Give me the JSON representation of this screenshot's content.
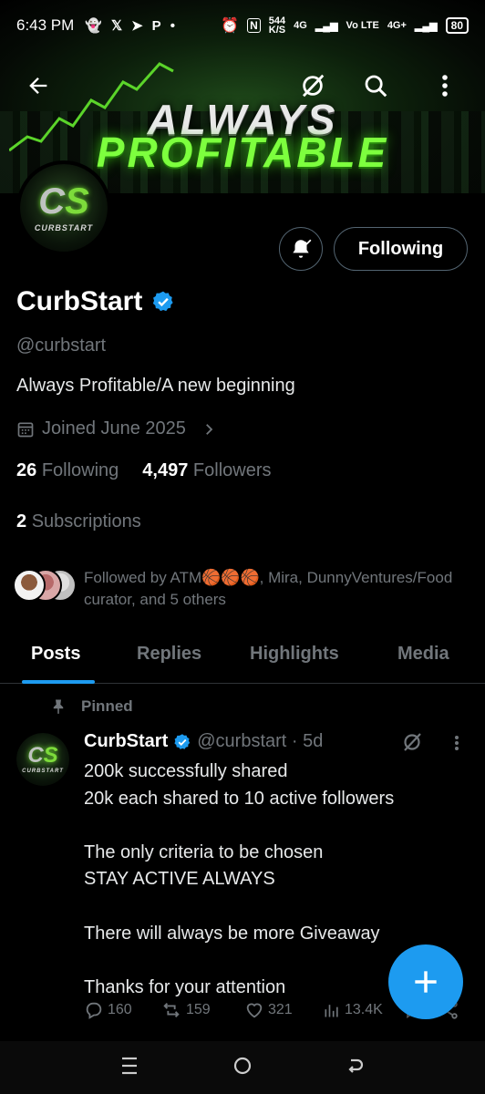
{
  "status_bar": {
    "time": "6:43 PM",
    "speed": "544",
    "speed_unit": "K/S",
    "net1": "4G",
    "volte": "Vo LTE",
    "net2": "4G+",
    "battery": "80"
  },
  "banner": {
    "line1": "ALWAYS",
    "line2": "PROFITABLE"
  },
  "avatar": {
    "letters_a": "C",
    "letters_b": "S",
    "word": "CURBSTART"
  },
  "profile": {
    "name": "CurbStart",
    "handle": "@curbstart",
    "bio": "Always Profitable/A new beginning",
    "joined": "Joined June 2025",
    "following_count": "26",
    "following_label": "Following",
    "followers_count": "4,497",
    "followers_label": "Followers",
    "subscriptions_count": "2",
    "subscriptions_label": "Subscriptions",
    "followed_by": "Followed by ATM🏀🏀🏀, Mira, DunnyVentures/Food curator, and 5 others",
    "follow_button": "Following"
  },
  "tabs": [
    {
      "label": "Posts"
    },
    {
      "label": "Replies"
    },
    {
      "label": "Highlights"
    },
    {
      "label": "Media"
    }
  ],
  "post": {
    "pinned_label": "Pinned",
    "author": "CurbStart",
    "handle_time": "@curbstart · 5d",
    "lines": [
      "200k successfully shared",
      "20k each shared to 10 active followers",
      "",
      "The only criteria to be chosen",
      "STAY ACTIVE ALWAYS",
      "",
      "There will always be more Giveaway",
      "",
      "Thanks for your attention"
    ],
    "replies": "160",
    "reposts": "159",
    "likes": "321",
    "views": "13.4K"
  },
  "colors": {
    "accent": "#1d9bf0",
    "banner_green": "#7dff3e",
    "muted": "#71767b"
  },
  "icons": [
    "back-arrow-icon",
    "grok-icon",
    "search-icon",
    "more-vertical-icon",
    "bell-icon",
    "verified-icon",
    "calendar-icon",
    "chevron-right-icon",
    "pin-icon",
    "reply-icon",
    "repost-icon",
    "like-icon",
    "views-icon",
    "bookmark-icon",
    "share-icon",
    "plus-icon",
    "menu-icon",
    "home-circle-icon",
    "back-icon"
  ]
}
